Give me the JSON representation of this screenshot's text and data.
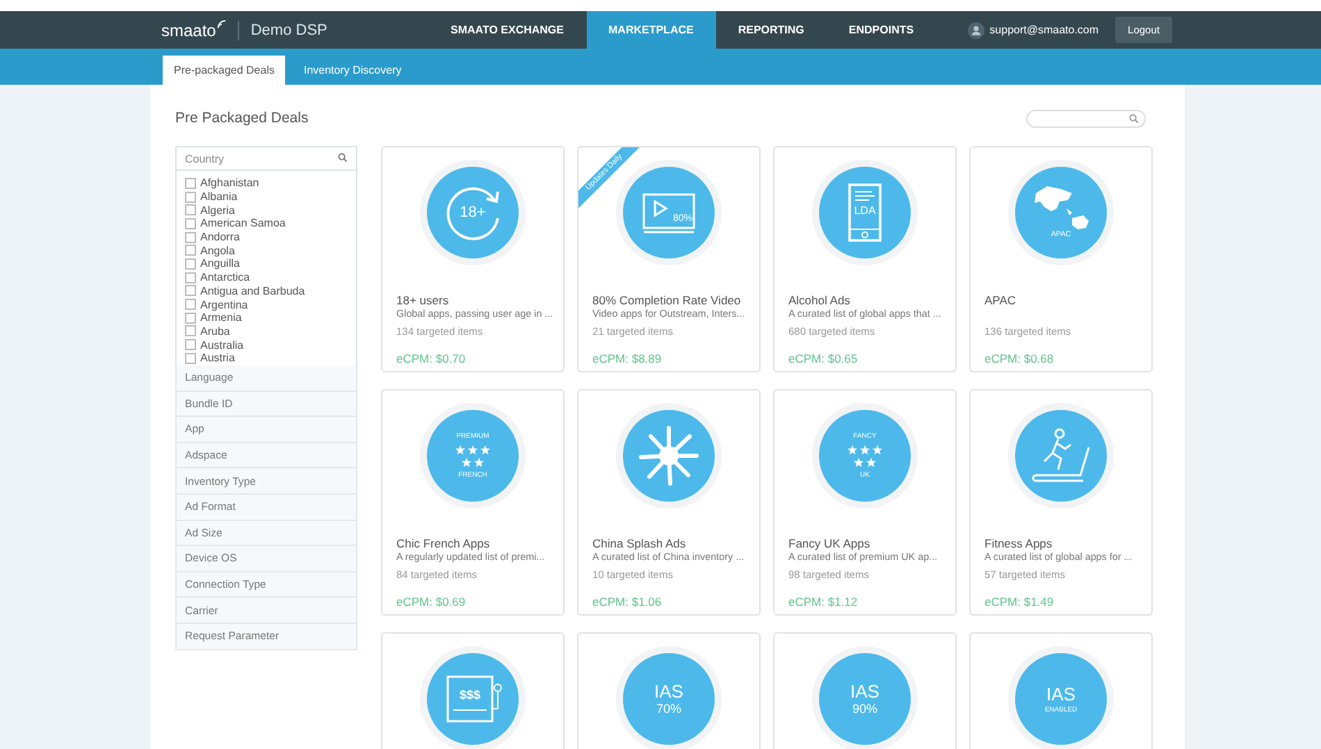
{
  "header": {
    "logo": "smaato",
    "app_name": "Demo DSP",
    "nav": [
      {
        "label": "SMAATO EXCHANGE",
        "selected": false
      },
      {
        "label": "MARKETPLACE",
        "selected": true
      },
      {
        "label": "REPORTING",
        "selected": false
      },
      {
        "label": "ENDPOINTS",
        "selected": false
      }
    ],
    "user_email": "support@smaato.com",
    "logout": "Logout"
  },
  "subnav": [
    {
      "label": "Pre-packaged Deals",
      "selected": true
    },
    {
      "label": "Inventory Discovery",
      "selected": false
    }
  ],
  "page_title": "Pre Packaged Deals",
  "filters": {
    "country": {
      "placeholder": "Country",
      "options": [
        {
          "label": "Afghanistan",
          "checked": false
        },
        {
          "label": "Albania",
          "checked": false
        },
        {
          "label": "Algeria",
          "checked": false
        },
        {
          "label": "American Samoa",
          "checked": false
        },
        {
          "label": "Andorra",
          "checked": false
        },
        {
          "label": "Angola",
          "checked": false
        },
        {
          "label": "Anguilla",
          "checked": false
        },
        {
          "label": "Antarctica",
          "checked": false
        },
        {
          "label": "Antigua and Barbuda",
          "checked": false
        },
        {
          "label": "Argentina",
          "checked": false
        },
        {
          "label": "Armenia",
          "checked": false
        },
        {
          "label": "Aruba",
          "checked": false
        },
        {
          "label": "Australia",
          "checked": false
        },
        {
          "label": "Austria",
          "checked": false
        }
      ]
    },
    "sections": [
      "Language",
      "Bundle ID",
      "App",
      "Adspace",
      "Inventory Type",
      "Ad Format",
      "Ad Size",
      "Device OS",
      "Connection Type",
      "Carrier",
      "Request Parameter"
    ]
  },
  "deals": [
    {
      "kind": "cycle",
      "icon_text": [
        "18+"
      ],
      "title": "18+ users",
      "description": "Global apps, passing user age in ...",
      "items": "134 targeted items",
      "ecpm": "eCPM: $0.70"
    },
    {
      "kind": "video",
      "icon_text": [
        "80%"
      ],
      "ribbon": "Updates Daily",
      "title": "80% Completion Rate Video",
      "description": "Video apps for Outstream, Inters...",
      "items": "21 targeted items",
      "ecpm": "eCPM: $8.89"
    },
    {
      "kind": "phone",
      "icon_text": [
        "LDA"
      ],
      "title": "Alcohol Ads",
      "description": "A curated list of global apps that ...",
      "items": "680 targeted items",
      "ecpm": "eCPM: $0.65"
    },
    {
      "kind": "globe",
      "icon_text": [
        "APAC"
      ],
      "title": "APAC",
      "items": "136 targeted items",
      "ecpm": "eCPM: $0.68"
    },
    {
      "kind": "stars",
      "icon_text": [
        "PREMIUM",
        "FRENCH"
      ],
      "title": "Chic French Apps",
      "description": "A regularly updated list of premi...",
      "items": "84 targeted items",
      "ecpm": "eCPM: $0.69"
    },
    {
      "kind": "splash",
      "title": "China Splash Ads",
      "description": "A curated list of China inventory ...",
      "items": "10 targeted items",
      "ecpm": "eCPM: $1.06"
    },
    {
      "kind": "stars",
      "icon_text": [
        "FANCY",
        "UK"
      ],
      "title": "Fancy UK Apps",
      "description": "A curated list of premium UK ap...",
      "items": "98 targeted items",
      "ecpm": "eCPM: $1.12"
    },
    {
      "kind": "treadmill",
      "title": "Fitness Apps",
      "description": "A curated list of global apps for ...",
      "items": "57 targeted items",
      "ecpm": "eCPM: $1.49"
    },
    {
      "kind": "slot",
      "icon_text": [
        "$$$"
      ]
    },
    {
      "kind": "badge",
      "icon_text": [
        "IAS",
        "70%"
      ]
    },
    {
      "kind": "badge",
      "icon_text": [
        "IAS",
        "90%"
      ]
    },
    {
      "kind": "badge",
      "icon_text": [
        "IAS",
        "ENABLED"
      ]
    }
  ]
}
